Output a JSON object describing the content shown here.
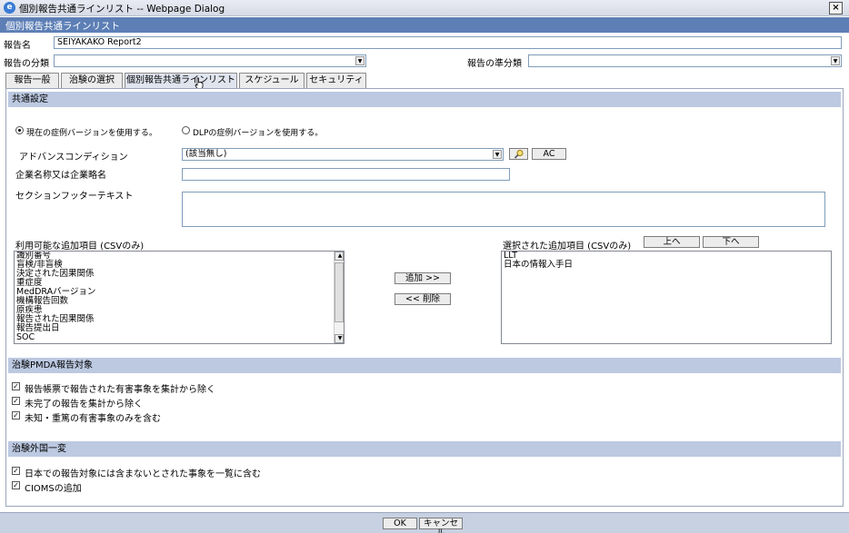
{
  "window": {
    "title": "個別報告共通ラインリスト -- Webpage Dialog",
    "close": "×"
  },
  "app": {
    "header": "個別報告共通ラインリスト"
  },
  "report_name": {
    "label": "報告名",
    "value": "SEIYAKAKO Report2"
  },
  "classification": {
    "label": "報告の分類",
    "value": ""
  },
  "sub_classification": {
    "label": "報告の準分類",
    "value": ""
  },
  "tabs": [
    {
      "label": "報告一般"
    },
    {
      "label": "治験の選択"
    },
    {
      "label": "個別報告共通ラインリスト"
    },
    {
      "label": "スケジュール"
    },
    {
      "label": "セキュリティ"
    }
  ],
  "common": {
    "header": "共通設定",
    "radio_current": "現在の症例バージョンを使用する。",
    "radio_dlp": "DLPの症例バージョンを使用する。",
    "advanced_label": "アドバンスコンディション",
    "advanced_value": "(該当無し)",
    "ac_button": "AC",
    "company_label": "企業名称又は企業略名",
    "company_value": "",
    "footer_label": "セクションフッターテキスト",
    "footer_value": ""
  },
  "available": {
    "label": "利用可能な追加項目 (CSVのみ)",
    "items": [
      "識別番号",
      "盲検/非盲検",
      "決定された因果関係",
      "重症度",
      "MedDRAバージョン",
      "機構報告回数",
      "原疾患",
      "報告された因果関係",
      "報告提出日",
      "SOC"
    ]
  },
  "buttons": {
    "add": "追加 >>",
    "remove": "<< 削除",
    "up": "上へ",
    "down": "下へ",
    "ok": "OK",
    "cancel": "キャンセル"
  },
  "selected": {
    "label": "選択された追加項目 (CSVのみ)",
    "items": [
      "LLT",
      "日本の情報入手日"
    ]
  },
  "pmda": {
    "header": "治験PMDA報告対象",
    "checks": [
      {
        "label": "報告帳票で報告された有害事象を集計から除く",
        "checked": true
      },
      {
        "label": "未完了の報告を集計から除く",
        "checked": true
      },
      {
        "label": "未知・重篤の有害事象のみを含む",
        "checked": true
      }
    ]
  },
  "foreign": {
    "header": "治験外国一変",
    "checks": [
      {
        "label": "日本での報告対象には含まないとされた事象を一覧に含む",
        "checked": true
      },
      {
        "label": "CIOMSの追加",
        "checked": true
      }
    ]
  },
  "icons": {
    "search": "search-icon",
    "check": "✓"
  }
}
